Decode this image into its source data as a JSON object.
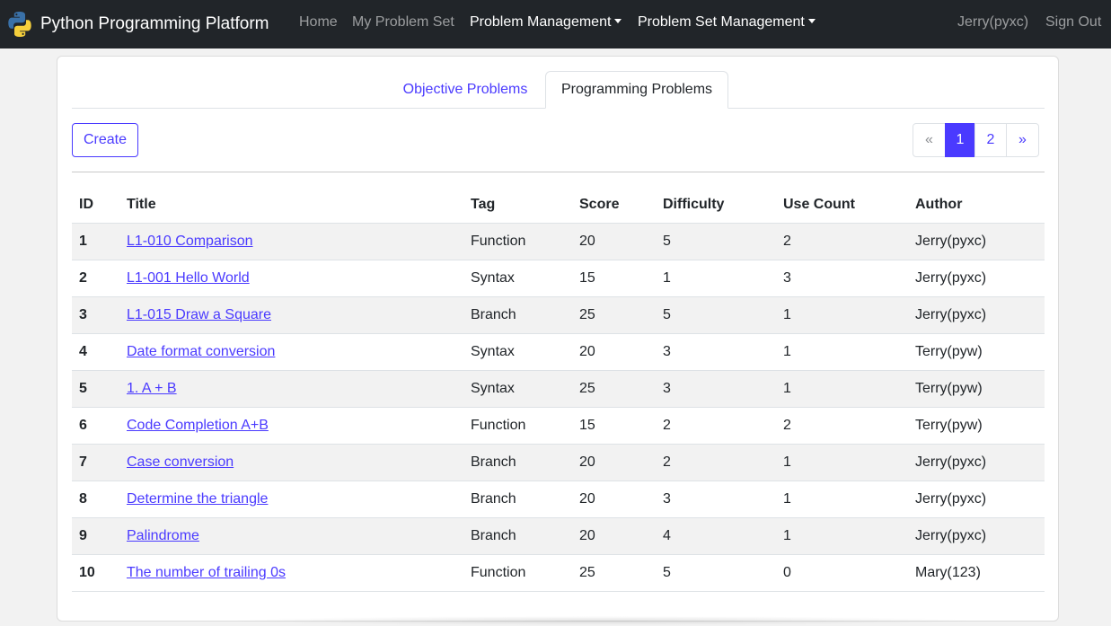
{
  "navbar": {
    "brand": "Python Programming Platform",
    "logo_icon": "python-logo-icon",
    "links": {
      "home": "Home",
      "my_problem_set": "My Problem Set",
      "problem_management": "Problem Management",
      "problem_set_management": "Problem Set Management"
    },
    "user": "Jerry(pyxc)",
    "sign_out": "Sign Out"
  },
  "tabs": {
    "objective": "Objective Problems",
    "programming": "Programming Problems",
    "active": "programming"
  },
  "toolbar": {
    "create_label": "Create"
  },
  "pagination": {
    "prev": "«",
    "pages": [
      "1",
      "2"
    ],
    "current": "1",
    "next": "»"
  },
  "table": {
    "headers": {
      "id": "ID",
      "title": "Title",
      "tag": "Tag",
      "score": "Score",
      "difficulty": "Difficulty",
      "use_count": "Use Count",
      "author": "Author"
    },
    "rows": [
      {
        "id": "1",
        "title": "L1-010 Comparison",
        "tag": "Function",
        "score": "20",
        "difficulty": "5",
        "use_count": "2",
        "author": "Jerry(pyxc)"
      },
      {
        "id": "2",
        "title": "L1-001 Hello World",
        "tag": "Syntax",
        "score": "15",
        "difficulty": "1",
        "use_count": "3",
        "author": "Jerry(pyxc)"
      },
      {
        "id": "3",
        "title": "L1-015 Draw a Square",
        "tag": "Branch",
        "score": "25",
        "difficulty": "5",
        "use_count": "1",
        "author": "Jerry(pyxc)"
      },
      {
        "id": "4",
        "title": "Date format conversion",
        "tag": "Syntax",
        "score": "20",
        "difficulty": "3",
        "use_count": "1",
        "author": "Terry(pyw)"
      },
      {
        "id": "5",
        "title": "1. A + B",
        "tag": "Syntax",
        "score": "25",
        "difficulty": "3",
        "use_count": "1",
        "author": "Terry(pyw)"
      },
      {
        "id": "6",
        "title": "Code Completion A+B",
        "tag": "Function",
        "score": "15",
        "difficulty": "2",
        "use_count": "2",
        "author": "Terry(pyw)"
      },
      {
        "id": "7",
        "title": "Case conversion",
        "tag": "Branch",
        "score": "20",
        "difficulty": "2",
        "use_count": "1",
        "author": "Jerry(pyxc)"
      },
      {
        "id": "8",
        "title": "Determine the triangle",
        "tag": "Branch",
        "score": "20",
        "difficulty": "3",
        "use_count": "1",
        "author": "Jerry(pyxc)"
      },
      {
        "id": "9",
        "title": "Palindrome",
        "tag": "Branch",
        "score": "20",
        "difficulty": "4",
        "use_count": "1",
        "author": "Jerry(pyxc)"
      },
      {
        "id": "10",
        "title": "The number of trailing 0s",
        "tag": "Function",
        "score": "25",
        "difficulty": "5",
        "use_count": "0",
        "author": "Mary(123)"
      }
    ]
  },
  "colors": {
    "navbar_bg": "#212529",
    "accent": "#4a3aff",
    "page_bg": "#f2f2f2",
    "stripe": "#f2f2f2"
  }
}
